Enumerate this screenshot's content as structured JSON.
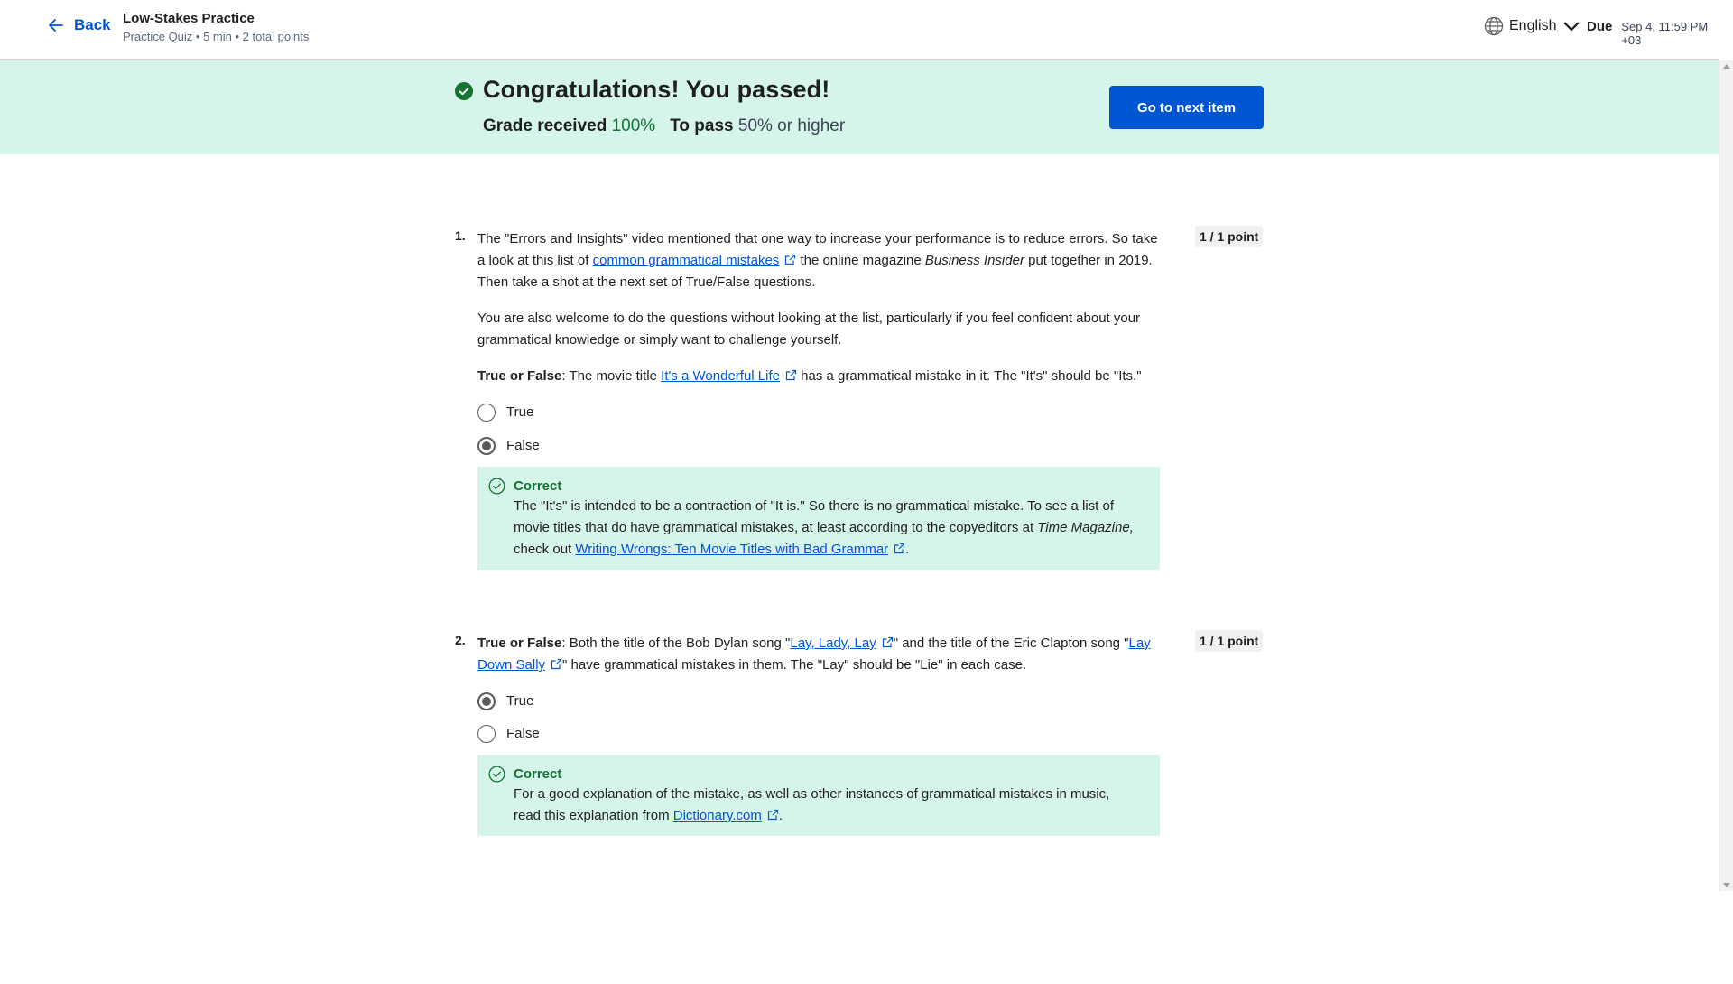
{
  "header": {
    "back_label": "Back",
    "title": "Low-Stakes Practice",
    "subtitle": "Practice Quiz • 5 min • 2 total points",
    "language": "English",
    "due_label": "Due",
    "due_value": "Sep 4, 11:59 PM +03"
  },
  "banner": {
    "title": "Congratulations! You passed!",
    "grade_label": "Grade received",
    "grade_value": "100%",
    "pass_label": "To pass",
    "pass_value": "50% or higher",
    "next_button": "Go to next item"
  },
  "questions": [
    {
      "number": "1.",
      "points": "1 / 1 point",
      "p1_a": "The \"Errors and Insights\" video mentioned that one way to increase your performance is to reduce errors. So take a look at this list of ",
      "p1_link": "common grammatical mistakes",
      "p1_b": " the online magazine ",
      "p1_italic": "Business Insider",
      "p1_c": " put together in 2019. Then take a shot at the next set of True/False questions.",
      "p2": "You are also welcome to do the questions without looking at the list, particularly if you feel confident about your grammatical knowledge or simply want to challenge yourself.",
      "p3_bold": "True or False",
      "p3_a": ": The movie title ",
      "p3_link": "It's a Wonderful Life",
      "p3_b": " has a grammatical mistake in it. The \"It's\" should be \"Its.\"",
      "options": [
        "True",
        "False"
      ],
      "selected": "False",
      "feedback": {
        "title": "Correct",
        "text_a": "The \"It's\" is intended to be a contraction of \"It is.\" So there is no grammatical mistake. To see a list of movie titles that do have grammatical mistakes, at least according to the copyeditors at ",
        "italic": "Time Magazine,",
        "text_b": " check out ",
        "link": "Writing Wrongs: Ten Movie Titles with Bad Grammar",
        "text_c": "."
      }
    },
    {
      "number": "2.",
      "points": "1 / 1 point",
      "p1_bold": "True or False",
      "p1_a": ": Both the title of the Bob Dylan song \"",
      "p1_link1": "Lay, Lady, Lay",
      "p1_b": "\" and the title of the Eric Clapton song \"",
      "p1_link2": "Lay Down Sally",
      "p1_c": "\" have grammatical mistakes in them. The \"Lay\" should be \"Lie\" in each case.",
      "options": [
        "True",
        "False"
      ],
      "selected": "True",
      "feedback": {
        "title": "Correct",
        "text_a": "For a good explanation of the mistake, as well as other instances of grammatical mistakes in music, read this explanation from ",
        "link": "Dictionary.com",
        "text_b": "."
      }
    }
  ],
  "colors": {
    "accent": "#0056d2",
    "banner_bg": "#d5f5ea",
    "success": "#137333"
  },
  "icons": {
    "back": "arrow-left-icon",
    "language": "globe-icon",
    "language_caret": "chevron-down-icon",
    "passed": "check-circle-icon",
    "external": "external-link-icon",
    "correct": "check-circle-outline-icon"
  }
}
